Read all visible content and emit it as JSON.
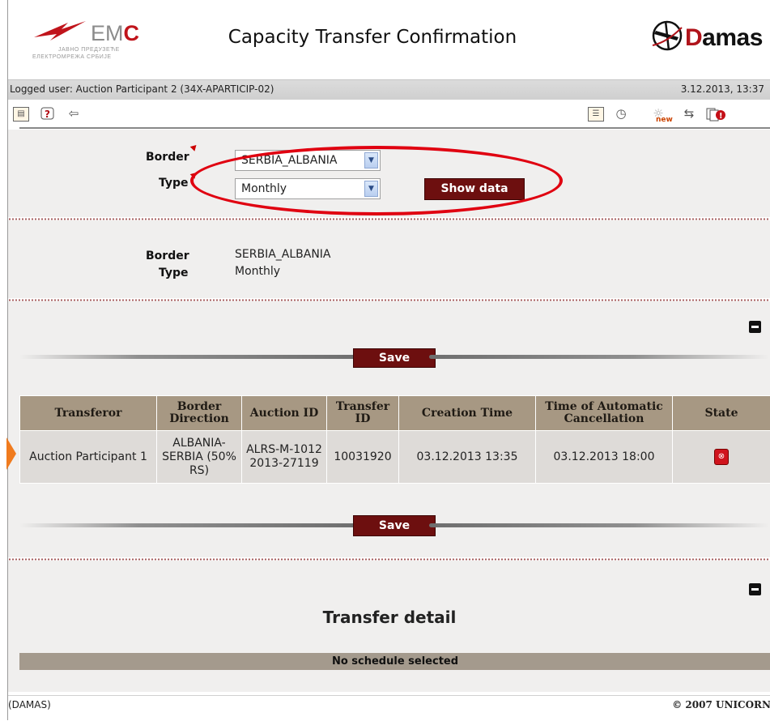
{
  "header": {
    "title": "Capacity Transfer Confirmation",
    "emc_logo": {
      "name": "EM",
      "accent": "C",
      "subtitle1": "ЈАВНО ПРЕДУЗЕЋЕ",
      "subtitle2": "ЕЛЕКТРОМРЕЖА СРБИЈЕ"
    },
    "damas_logo": {
      "accent": "D",
      "name": "amas"
    }
  },
  "userbar": {
    "logged_user": "Logged user: Auction Participant 2 (34X-APARTICIP-02)",
    "datetime": "3.12.2013, 13:37"
  },
  "toolbar": {
    "left_icons": [
      "document-icon",
      "help-icon",
      "back-arrow-icon"
    ],
    "right_icons": [
      "list-icon",
      "clock-icon",
      "new-bulb-icon",
      "transfer-arrows-icon",
      "pages-alert-icon"
    ],
    "new_label": "new"
  },
  "filter": {
    "border_label": "Border",
    "type_label": "Type",
    "border_value": "SERBIA_ALBANIA",
    "type_value": "Monthly",
    "show_button": "Show data"
  },
  "summary": {
    "border_label": "Border",
    "type_label": "Type",
    "border_value": "SERBIA_ALBANIA",
    "type_value": "Monthly"
  },
  "transfers": {
    "save_label": "Save",
    "columns": [
      "Transferor",
      "Border Direction",
      "Auction ID",
      "Transfer ID",
      "Creation Time",
      "Time of Automatic Cancellation",
      "State"
    ],
    "rows": [
      {
        "transferor": "Auction Participant 1",
        "border_direction": "ALBANIA-SERBIA (50% RS)",
        "auction_id": "ALRS-M-10122013-27119",
        "transfer_id": "10031920",
        "creation_time": "03.12.2013 13:35",
        "cancellation_time": "03.12.2013 18:00",
        "state_icon": "cancel-icon"
      }
    ]
  },
  "detail": {
    "title": "Transfer detail",
    "empty_message": "No schedule selected"
  },
  "footer": {
    "left": "(DAMAS)",
    "right": "© 2007 UNICORN"
  },
  "colors": {
    "brand_dark_red": "#6d0f0f",
    "table_header": "#a79883",
    "highlight_ellipse": "#e00010",
    "pointer_orange": "#f07b1e"
  }
}
